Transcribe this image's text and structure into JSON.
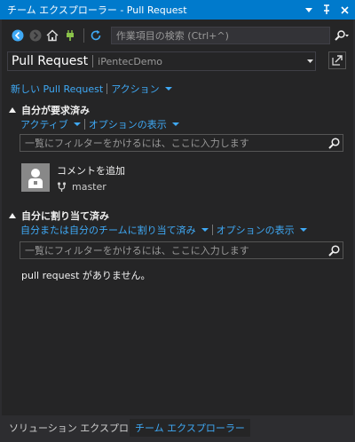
{
  "window": {
    "title": "チーム エクスプローラー - Pull Request"
  },
  "toolbar": {
    "search_placeholder": "作業項目の検索 (Ctrl+^)"
  },
  "header": {
    "title": "Pull Request",
    "project": "iPentecDemo"
  },
  "actions": {
    "new_pr": "新しい Pull Request",
    "actions_menu": "アクション"
  },
  "requested_by_me": {
    "title": "自分が要求済み",
    "filter_active": "アクティブ",
    "view_options": "オプションの表示",
    "filter_placeholder": "一覧にフィルターをかけるには、ここに入力します",
    "items": [
      {
        "title": "コメントを追加",
        "branch": "master"
      }
    ]
  },
  "assigned_to_me": {
    "title": "自分に割り当て済み",
    "filter_scope": "自分または自分のチームに割り当て済み",
    "view_options": "オプションの表示",
    "filter_placeholder": "一覧にフィルターをかけるには、ここに入力します",
    "empty_message": "pull request がありません。"
  },
  "bottom_tabs": {
    "solution_explorer": "ソリューション エクスプローラー",
    "team_explorer": "チーム エクスプローラー"
  },
  "colors": {
    "accent": "#007acc",
    "link": "#3fa9f5",
    "background": "#252526"
  }
}
